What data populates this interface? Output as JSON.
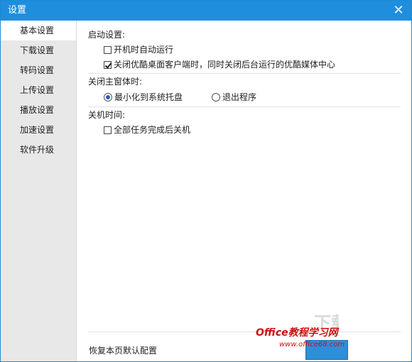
{
  "window": {
    "title": "设置",
    "close_glyph": "✕"
  },
  "sidebar": {
    "items": [
      {
        "label": "基本设置"
      },
      {
        "label": "下载设置"
      },
      {
        "label": "转码设置"
      },
      {
        "label": "上传设置"
      },
      {
        "label": "播放设置"
      },
      {
        "label": "加速设置"
      },
      {
        "label": "软件升级"
      }
    ],
    "active_index": 0
  },
  "startup": {
    "title": "启动设置:",
    "auto_run": {
      "label": "开机时自动运行",
      "checked": false
    },
    "close_bg": {
      "label": "关闭优酷桌面客户端时，同时关闭后台运行的优酷媒体中心",
      "checked": true
    }
  },
  "close_main": {
    "title": "关闭主窗体时:",
    "minimize": {
      "label": "最小化到系统托盘",
      "selected": true
    },
    "exit": {
      "label": "退出程序",
      "selected": false
    }
  },
  "shutdown": {
    "title": "关机时间:",
    "after_tasks": {
      "label": "全部任务完成后关机",
      "checked": false
    }
  },
  "footer": {
    "restore_label": "恢复本页默认配置"
  },
  "watermark": {
    "site": "Office教程学习网",
    "url": "www.office68.com"
  },
  "colors": {
    "titlebar": "#1f8fdd",
    "sidebar": "#e8e8e8"
  }
}
